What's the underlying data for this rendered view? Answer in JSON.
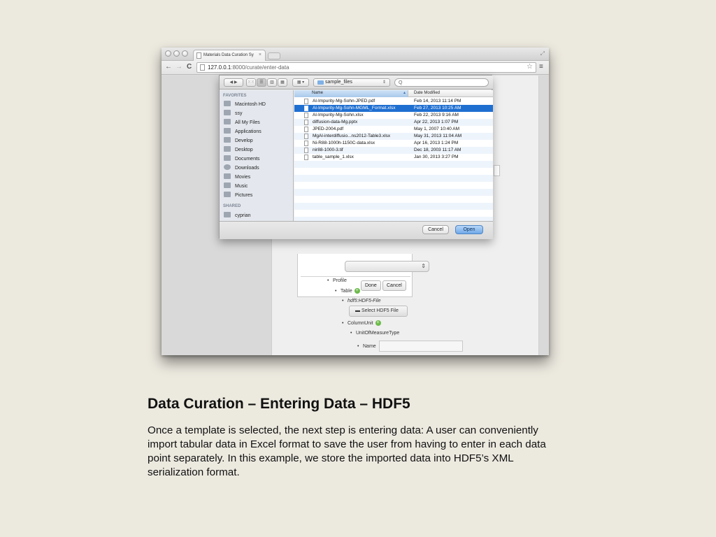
{
  "browser": {
    "tab_title": "Materials Data Curation Sy",
    "tab_close": "×",
    "url_host": "127.0.0.1",
    "url_port_path": ":8000/curate/enter-data",
    "back": "←",
    "forward": "→",
    "reload": "C",
    "star": "☆",
    "menu": "≡"
  },
  "dialog": {
    "location": "sample_files",
    "search_placeholder": "Q",
    "view_buttons": [
      "◀ ▶",
      "⁙⁙",
      "☰",
      "▥",
      "▦",
      "▦ ▾"
    ],
    "sidebar": {
      "favorites_header": "FAVORITES",
      "favorites": [
        "Macintosh HD",
        "ssy",
        "All My Files",
        "Applications",
        "Develop",
        "Desktop",
        "Documents",
        "Downloads",
        "Movies",
        "Music",
        "Pictures"
      ],
      "shared_header": "SHARED",
      "shared": [
        "cyprian"
      ]
    },
    "columns": {
      "name": "Name",
      "date": "Date Modified"
    },
    "files": [
      {
        "name": "Al-Impurity-Mg-Sohn-JPED.pdf",
        "date": "Feb 14, 2013 11:14 PM"
      },
      {
        "name": "Al-Impurity-Mg-Sohn-MGML_Format.xlsx",
        "date": "Feb 27, 2013 10:25 AM"
      },
      {
        "name": "Al-Impurity-Mg-Sohn.xlsx",
        "date": "Feb 22, 2013 9:16 AM"
      },
      {
        "name": "diffusion-data-Mg.pptx",
        "date": "Apr 22, 2013 1:07 PM"
      },
      {
        "name": "JPED-2004.pdf",
        "date": "May 1, 2007 10:40 AM"
      },
      {
        "name": "MgAl-interdiffusio...ns2012-Table3.xlsx",
        "date": "May 31, 2013 11:04 AM"
      },
      {
        "name": "Ni-R88-1000h-1150C-data.xlsx",
        "date": "Apr 16, 2013 1:24 PM"
      },
      {
        "name": "nir88-1000-3.tif",
        "date": "Dec 18, 2003 11:17 AM"
      },
      {
        "name": "table_sample_1.xlsx",
        "date": "Jan 30, 2013 3:27 PM"
      }
    ],
    "cancel": "Cancel",
    "open": "Open"
  },
  "modal": {
    "done": "Done",
    "cancel": "Cancel"
  },
  "form": {
    "profile": "Profile",
    "table": "Table",
    "hdf5_file": "hdf5:HDF5-File",
    "select_hdf5": "Select HDF5 File",
    "column_unit": "ColumnUnit",
    "unit_of_measure_type": "UnitOfMeasureType",
    "name": "Name",
    "bullet": "•",
    "plus": "+",
    "select_arrow": "⇕"
  },
  "caption": {
    "title": "Data Curation – Entering Data – HDF5",
    "body": "Once a template is selected, the next step is entering data: A user can conveniently import tabular data in Excel format to save the user from having to enter in each data point separately.  In this example, we store the imported data into HDF5’s XML serialization format."
  }
}
